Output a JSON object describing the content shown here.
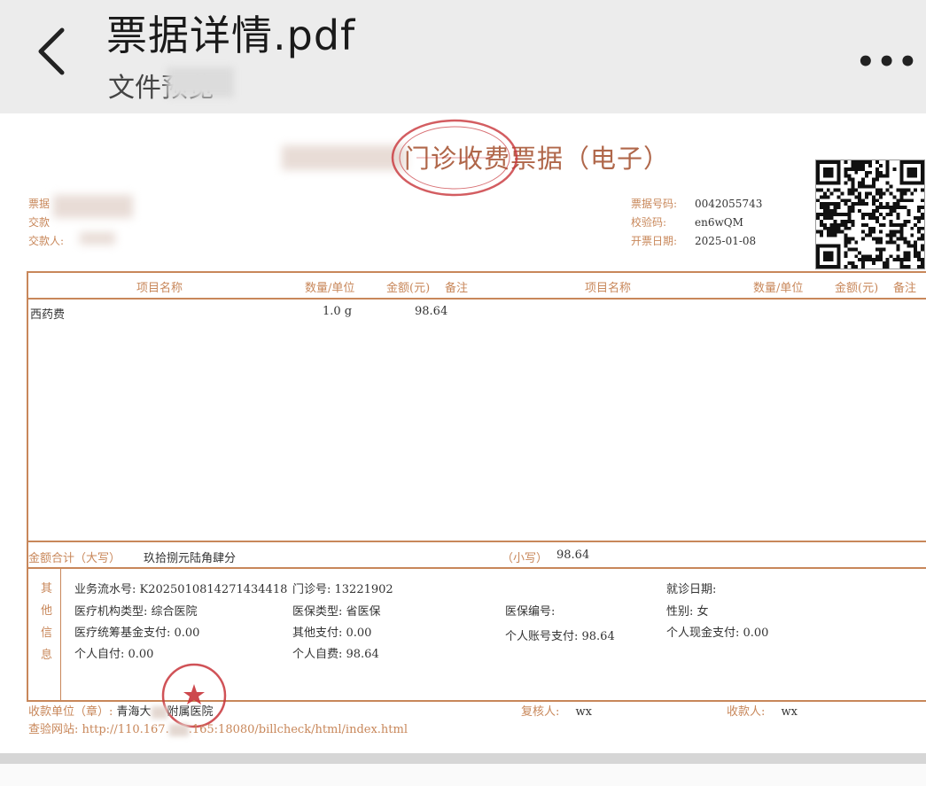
{
  "header": {
    "title": "票据详情.pdf",
    "subtitle": "文件预览"
  },
  "document": {
    "title": "门诊收费票据（电子）",
    "left_labels": [
      "票据",
      "交款",
      "交款人:"
    ],
    "bill_number_label": "票据号码:",
    "bill_number": "0042055743",
    "check_code_label": "校验码:",
    "check_code": "en6wQM",
    "issue_date_label": "开票日期:",
    "issue_date": "2025-01-08",
    "table": {
      "col_item": "项目名称",
      "col_qty": "数量/单位",
      "col_amount": "金额(元)",
      "col_note": "备注",
      "rows": [
        {
          "item": "西药费",
          "qty": "1.0 g",
          "amount": "98.64"
        }
      ]
    },
    "total_label": "金额合计（大写）",
    "total_words": "玖拾捌元陆角肆分",
    "total_small_label": "（小写）",
    "total_small": "98.64",
    "other_info_label": [
      "其",
      "他",
      "信",
      "息"
    ],
    "info": {
      "serial": "业务流水号: K20250108142714344​18",
      "outpatient_no": "门诊号: 13221902",
      "visit_date": "就诊日期:",
      "institution_type": "医疗机构类型: 综合医院",
      "insurance_type": "医保类型: 省医保",
      "insurance_no": "医保编号:",
      "gender": "性别: 女",
      "fund_pay": "医疗统筹基金支付: 0.00",
      "other_pay": "其他支付: 0.00",
      "account_pay": "个人账号支付: 98.64",
      "cash_pay": "个人现金支付: 0.00",
      "self_pay": "个人自付: 0.00",
      "self_fee": "个人自费: 98.64"
    },
    "footer": {
      "payee_unit_label": "收款单位（章）:",
      "payee_unit": "青海大",
      "payee_unit_tail": "附属医院",
      "reviewer_label": "复核人:",
      "reviewer": "wx",
      "cashier_label": "收款人:",
      "cashier": "wx",
      "check_site_label": "查验网站:",
      "check_site": "http://110.167.",
      "check_site_tail": ".165:18080/billcheck/html/index.html"
    }
  },
  "colors": {
    "accent": "#c8875a",
    "stamp": "#c8343a"
  }
}
